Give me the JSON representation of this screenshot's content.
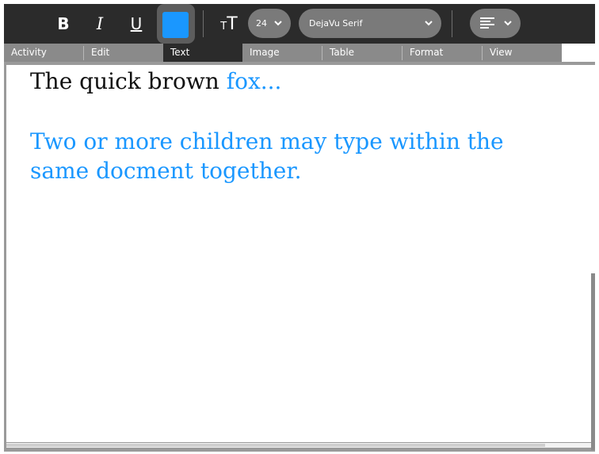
{
  "toolbar": {
    "bold_label": "B",
    "italic_label": "I",
    "underline_label": "U",
    "text_color": "#1a97ff",
    "text_size_icon_small": "T",
    "text_size_icon_large": "T",
    "font_size": "24",
    "font_family": "DejaVu Serif",
    "align_icon": "align-left-icon",
    "dropdown_icon": "chevron-down-icon"
  },
  "tabs": [
    {
      "label": "Activity",
      "active": false
    },
    {
      "label": "Edit",
      "active": false
    },
    {
      "label": "Text",
      "active": true
    },
    {
      "label": "Image",
      "active": false
    },
    {
      "label": "Table",
      "active": false
    },
    {
      "label": "Format",
      "active": false
    },
    {
      "label": "View",
      "active": false
    }
  ],
  "document": {
    "line1_black": "The quick brown ",
    "line1_blue": "fox...",
    "para2": "Two or more children may type within the same docment together.",
    "black_color": "#111111",
    "blue_color": "#1a97ff"
  }
}
